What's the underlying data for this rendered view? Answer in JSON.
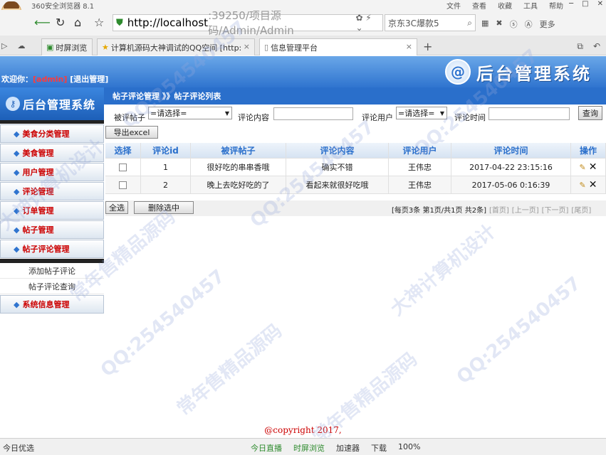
{
  "browser": {
    "name": "360安全浏览器 8.1",
    "menu": [
      "文件",
      "查看",
      "收藏",
      "工具",
      "帮助"
    ],
    "url_host": "http://localhost",
    "url_rest": ":39250/项目源码/Admin/Admin",
    "search_text": "京东3C爆款5",
    "toolbar_more": "更多",
    "tabs": [
      {
        "label": "时屏浏览"
      },
      {
        "label": "计算机源码大神调试的QQ空间 [http:"
      },
      {
        "label": "信息管理平台"
      }
    ],
    "status_left": "今日优选",
    "status_items": [
      "今日直播",
      "时屏浏览",
      "加速器",
      "下载",
      "100%"
    ]
  },
  "header": {
    "welcome_prefix": "欢迎你：",
    "username": "[admin]",
    "logout": "[退出管理]",
    "logo_text": "后台管理系统"
  },
  "sidebar": {
    "title": "后台管理系统",
    "items": [
      {
        "label": "美食分类管理"
      },
      {
        "label": "美食管理"
      },
      {
        "label": "用户管理"
      },
      {
        "label": "评论管理"
      },
      {
        "label": "订单管理"
      },
      {
        "label": "帖子管理"
      },
      {
        "label": "帖子评论管理"
      }
    ],
    "sub_items": [
      "添加帖子评论",
      "帖子评论查询"
    ],
    "last_item": "系统信息管理"
  },
  "breadcrumb": "帖子评论管理 》》帖子评论列表",
  "filters": {
    "post_label": "被评帖子",
    "post_value": "=请选择=",
    "content_label": "评论内容",
    "user_label": "评论用户",
    "user_value": "=请选择=",
    "time_label": "评论时间",
    "query_button": "查询"
  },
  "export_button": "导出excel",
  "table": {
    "columns": [
      "选择",
      "评论id",
      "被评帖子",
      "评论内容",
      "评论用户",
      "评论时间",
      "操作"
    ],
    "rows": [
      {
        "id": "1",
        "post": "很好吃的串串香哦",
        "content": "确实不错",
        "user": "王伟忠",
        "time": "2017-04-22 23:15:16"
      },
      {
        "id": "2",
        "post": "晚上去吃好吃的了",
        "content": "看起来就很好吃哦",
        "user": "王伟忠",
        "time": "2017-05-06 0:16:39"
      }
    ]
  },
  "actions": {
    "select_all": "全选",
    "delete_selected": "删除选中"
  },
  "pager": {
    "per_page": "[每页3条 第1页/共1页 共2条]",
    "first": "[首页]",
    "prev": "[上一页]",
    "next": "[下一页]",
    "last": "[尾页]"
  },
  "copyright": "@copyright 2017,",
  "watermarks": [
    "QQ:254540457",
    "常年售精品源码",
    "大神计算机设计"
  ]
}
